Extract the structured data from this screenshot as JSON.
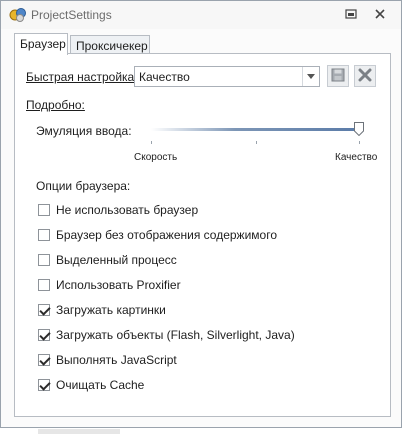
{
  "window": {
    "title": "ProjectSettings"
  },
  "tabs": [
    {
      "label": "Браузер",
      "active": true
    },
    {
      "label": "Проксичекер",
      "active": false
    }
  ],
  "quick": {
    "label": "Быстрая настройка:",
    "value": "Качество"
  },
  "details_label": "Подробно:",
  "slider": {
    "label": "Эмуляция ввода:",
    "min_label": "Скорость",
    "max_label": "Качество",
    "level": 1.0
  },
  "options": {
    "title": "Опции браузера:",
    "items": [
      {
        "label": "Не использовать браузер",
        "checked": false
      },
      {
        "label": "Браузер без отображения содержимого",
        "checked": false
      },
      {
        "label": "Выделенный процесс",
        "checked": false
      },
      {
        "label": "Использовать Proxifier",
        "checked": false
      },
      {
        "label": "Загружать картинки",
        "checked": true
      },
      {
        "label": "Загружать объекты (Flash, Silverlight, Java)",
        "checked": true
      },
      {
        "label": "Выполнять JavaScript",
        "checked": true
      },
      {
        "label": "Очищать Cache",
        "checked": true
      }
    ]
  },
  "icons": {
    "app": "app-logo-icon",
    "restore": "restore-icon",
    "close": "close-icon",
    "dropdown": "chevron-down-icon",
    "save": "save-icon",
    "delete": "delete-icon"
  }
}
